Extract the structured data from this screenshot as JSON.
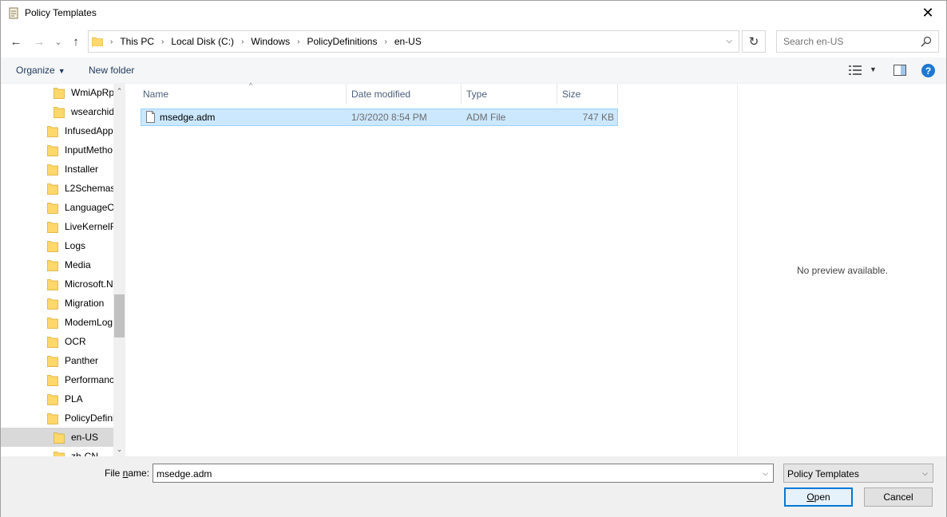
{
  "window": {
    "title": "Policy Templates",
    "close_glyph": "✕"
  },
  "nav": {
    "back_glyph": "←",
    "forward_glyph": "→",
    "recent_glyph": "⌄",
    "up_glyph": "↑",
    "breadcrumbs": [
      "This PC",
      "Local Disk (C:)",
      "Windows",
      "PolicyDefinitions",
      "en-US"
    ],
    "refresh_glyph": "↻",
    "search_placeholder": "Search en-US"
  },
  "command_bar": {
    "organize_label": "Organize",
    "new_folder_label": "New folder"
  },
  "tree": {
    "items": [
      {
        "label": "WmiApRp",
        "indent": 2
      },
      {
        "label": "wsearchid",
        "indent": 2
      },
      {
        "label": "InfusedApp",
        "indent": 1
      },
      {
        "label": "InputMetho",
        "indent": 1
      },
      {
        "label": "Installer",
        "indent": 1
      },
      {
        "label": "L2Schemas",
        "indent": 1
      },
      {
        "label": "LanguageO",
        "indent": 1
      },
      {
        "label": "LiveKernelR",
        "indent": 1
      },
      {
        "label": "Logs",
        "indent": 1
      },
      {
        "label": "Media",
        "indent": 1
      },
      {
        "label": "Microsoft.N",
        "indent": 1
      },
      {
        "label": "Migration",
        "indent": 1
      },
      {
        "label": "ModemLog",
        "indent": 1
      },
      {
        "label": "OCR",
        "indent": 1
      },
      {
        "label": "Panther",
        "indent": 1
      },
      {
        "label": "Performanc",
        "indent": 1
      },
      {
        "label": "PLA",
        "indent": 1
      },
      {
        "label": "PolicyDefini",
        "indent": 1
      },
      {
        "label": "en-US",
        "indent": 2,
        "selected": true
      },
      {
        "label": "zh-CN",
        "indent": 2
      }
    ]
  },
  "file_list": {
    "columns": [
      "Name",
      "Date modified",
      "Type",
      "Size"
    ],
    "sort_glyph": "^",
    "rows": [
      {
        "name": "msedge.adm",
        "date_modified": "1/3/2020 8:54 PM",
        "type": "ADM File",
        "size": "747 KB"
      }
    ]
  },
  "preview": {
    "message": "No preview available."
  },
  "bottom": {
    "file_name_label_pre": "File ",
    "file_name_label_u": "n",
    "file_name_label_post": "ame:",
    "file_name_value": "msedge.adm",
    "file_type_value": "Policy Templates",
    "open_label_u": "O",
    "open_label_rest": "pen",
    "cancel_label": "Cancel"
  },
  "colors": {
    "selection_bg": "#cce8ff",
    "selection_border": "#99d1ff",
    "folder_yellow": "#ffd86b",
    "accent_blue": "#0078d7"
  }
}
